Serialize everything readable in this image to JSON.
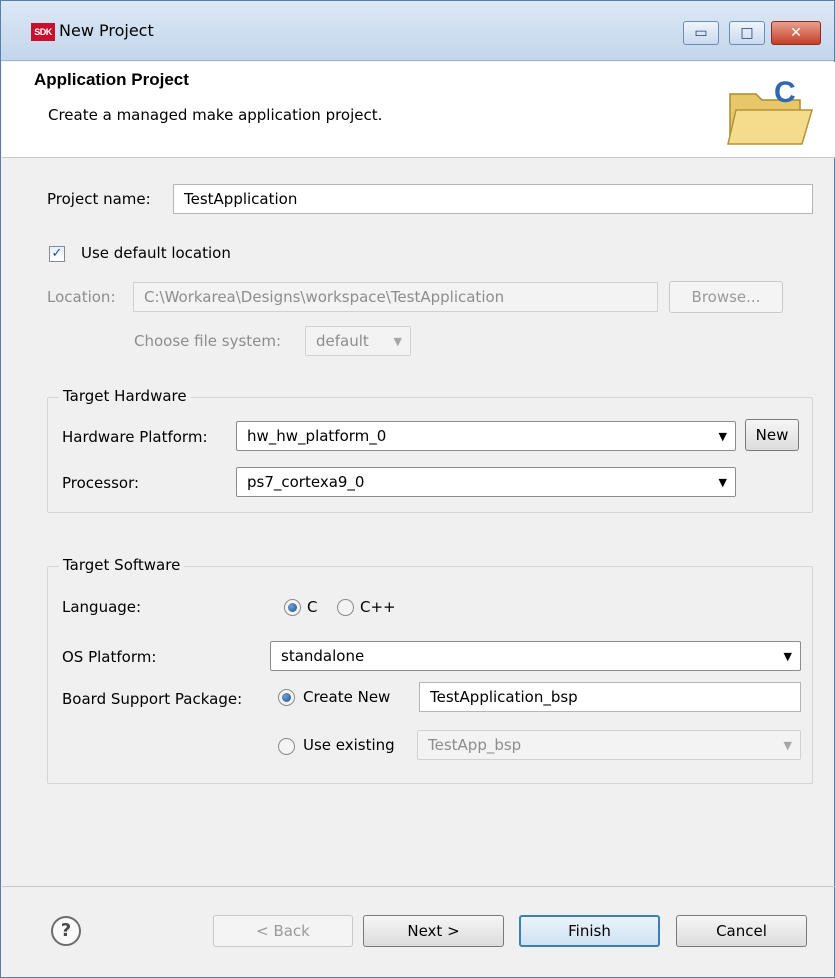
{
  "window": {
    "app_icon_text": "SDK",
    "title": "New Project",
    "controls": {
      "minimize": "▭",
      "maximize": "□",
      "close": "✕"
    }
  },
  "header": {
    "title": "Application Project",
    "description": "Create a managed make application project.",
    "icon": "folder-c-icon"
  },
  "project": {
    "name_label": "Project name:",
    "name_value": "TestApplication",
    "use_default_label": "Use default location",
    "use_default_checked": true,
    "location_label": "Location:",
    "location_value": "C:\\Workarea\\Designs\\workspace\\TestApplication",
    "browse_label": "Browse...",
    "filesystem_label": "Choose file system:",
    "filesystem_value": "default"
  },
  "target_hardware": {
    "group_title": "Target Hardware",
    "platform_label": "Hardware Platform:",
    "platform_value": "hw_hw_platform_0",
    "new_label": "New",
    "processor_label": "Processor:",
    "processor_value": "ps7_cortexa9_0"
  },
  "target_software": {
    "group_title": "Target Software",
    "language_label": "Language:",
    "language_options": [
      "C",
      "C++"
    ],
    "language_selected": "C",
    "os_label": "OS Platform:",
    "os_value": "standalone",
    "bsp_label": "Board Support Package:",
    "create_new_label": "Create New",
    "create_new_value": "TestApplication_bsp",
    "use_existing_label": "Use existing",
    "use_existing_value": "TestApp_bsp",
    "bsp_mode": "Create New"
  },
  "footer": {
    "help_icon": "help-icon",
    "back_label": "< Back",
    "next_label": "Next >",
    "finish_label": "Finish",
    "cancel_label": "Cancel"
  }
}
